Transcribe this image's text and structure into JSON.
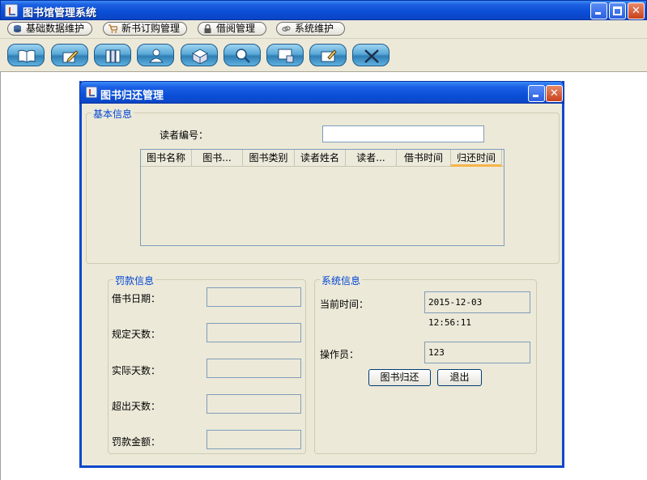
{
  "window": {
    "title": "图书馆管理系统"
  },
  "menu": [
    {
      "label": "基础数据维护",
      "icon": "database-icon"
    },
    {
      "label": "新书订购管理",
      "icon": "cart-icon"
    },
    {
      "label": "借阅管理",
      "icon": "lock-icon"
    },
    {
      "label": "系统维护",
      "icon": "link-icon"
    }
  ],
  "toolbar": [
    {
      "name": "book-icon"
    },
    {
      "name": "edit-icon"
    },
    {
      "name": "books-icon"
    },
    {
      "name": "reader-icon"
    },
    {
      "name": "box-icon"
    },
    {
      "name": "search-icon"
    },
    {
      "name": "screen-icon"
    },
    {
      "name": "card-icon"
    },
    {
      "name": "tools-icon"
    }
  ],
  "dialog": {
    "title": "图书归还管理",
    "basic": {
      "legend": "基本信息",
      "reader_id_label": "读者编号：",
      "reader_id_value": "",
      "columns": [
        "图书名称",
        "图书...",
        "图书类别",
        "读者姓名",
        "读者...",
        "借书时间",
        "归还时间"
      ],
      "rows": []
    },
    "fine": {
      "legend": "罚款信息",
      "borrow_date_label": "借书日期：",
      "limit_days_label": "规定天数：",
      "actual_days_label": "实际天数：",
      "over_days_label": "超出天数：",
      "fine_amount_label": "罚款金额：",
      "borrow_date": "",
      "limit_days": "",
      "actual_days": "",
      "over_days": "",
      "fine_amount": ""
    },
    "system": {
      "legend": "系统信息",
      "current_time_label": "当前时间：",
      "current_time": "2015-12-03 12:56:11",
      "operator_label": "操作员：",
      "operator": "123",
      "return_button": "图书归还",
      "exit_button": "退出"
    }
  }
}
